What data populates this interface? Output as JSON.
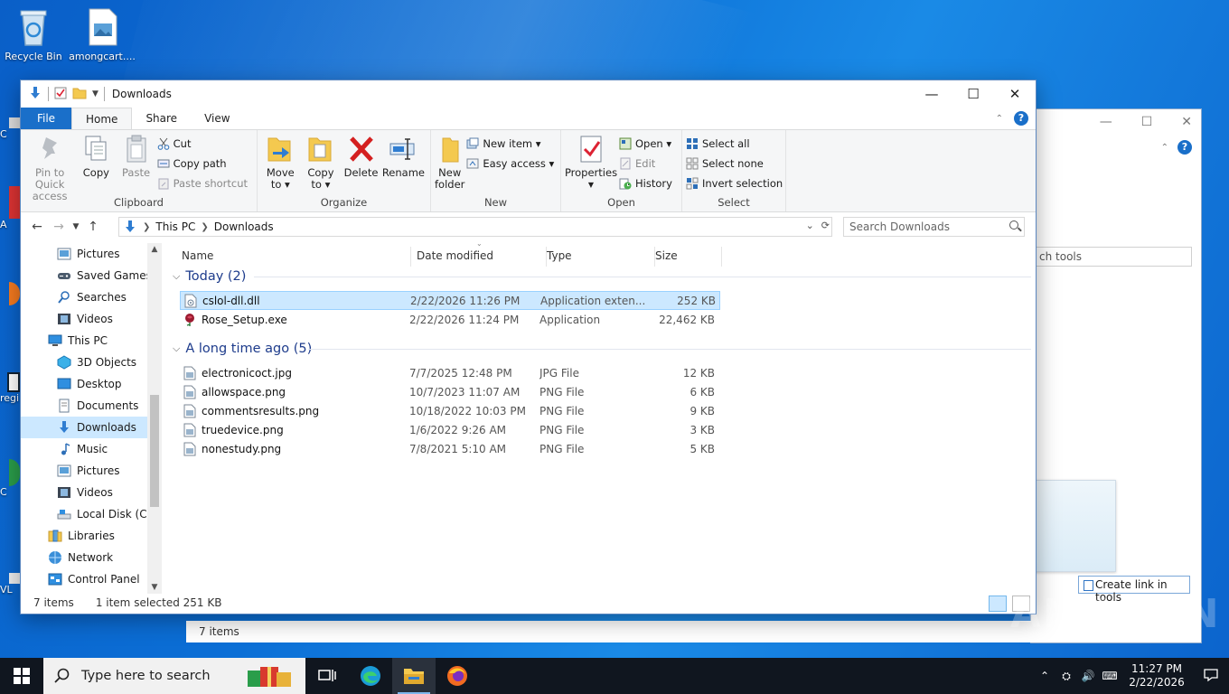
{
  "desktop": {
    "icons": [
      {
        "label": "Recycle Bin",
        "icon": "recycle-bin-icon"
      },
      {
        "label": "amongcart....",
        "icon": "image-file-icon"
      }
    ],
    "edge_labels": [
      "C",
      "A",
      "regi",
      "C",
      "VL"
    ]
  },
  "bg_window": {
    "search_placeholder": "ch tools",
    "create_link": "Create link in tools"
  },
  "window": {
    "title": "Downloads",
    "tabs": {
      "file": "File",
      "home": "Home",
      "share": "Share",
      "view": "View"
    },
    "ribbon": {
      "clipboard": {
        "label": "Clipboard",
        "pin": "Pin to Quick access",
        "copy": "Copy",
        "paste": "Paste",
        "cut": "Cut",
        "copy_path": "Copy path",
        "paste_shortcut": "Paste shortcut"
      },
      "organize": {
        "label": "Organize",
        "move_to": "Move to ▾",
        "copy_to": "Copy to ▾",
        "delete": "Delete",
        "rename": "Rename"
      },
      "new": {
        "label": "New",
        "new_folder": "New folder",
        "new_item": "New item ▾",
        "easy_access": "Easy access ▾"
      },
      "open": {
        "label": "Open",
        "properties": "Properties",
        "open": "Open ▾",
        "edit": "Edit",
        "history": "History"
      },
      "select": {
        "label": "Select",
        "select_all": "Select all",
        "select_none": "Select none",
        "invert": "Invert selection"
      }
    },
    "address": {
      "crumbs": [
        "This PC",
        "Downloads"
      ]
    },
    "search_placeholder": "Search Downloads",
    "nav": [
      {
        "label": "Pictures",
        "level": 1,
        "icon": "pictures-icon"
      },
      {
        "label": "Saved Games",
        "level": 1,
        "icon": "saved-games-icon"
      },
      {
        "label": "Searches",
        "level": 1,
        "icon": "searches-icon"
      },
      {
        "label": "Videos",
        "level": 1,
        "icon": "videos-icon"
      },
      {
        "label": "This PC",
        "level": 0,
        "icon": "this-pc-icon"
      },
      {
        "label": "3D Objects",
        "level": 1,
        "icon": "3d-objects-icon"
      },
      {
        "label": "Desktop",
        "level": 1,
        "icon": "desktop-icon"
      },
      {
        "label": "Documents",
        "level": 1,
        "icon": "documents-icon"
      },
      {
        "label": "Downloads",
        "level": 1,
        "icon": "downloads-icon",
        "selected": true
      },
      {
        "label": "Music",
        "level": 1,
        "icon": "music-icon"
      },
      {
        "label": "Pictures",
        "level": 1,
        "icon": "pictures-icon"
      },
      {
        "label": "Videos",
        "level": 1,
        "icon": "videos-icon"
      },
      {
        "label": "Local Disk (C:)",
        "level": 1,
        "icon": "local-disk-icon"
      },
      {
        "label": "Libraries",
        "level": 0,
        "icon": "libraries-icon"
      },
      {
        "label": "Network",
        "level": 0,
        "icon": "network-icon"
      },
      {
        "label": "Control Panel",
        "level": 0,
        "icon": "control-panel-icon"
      }
    ],
    "columns": {
      "name": "Name",
      "date": "Date modified",
      "type": "Type",
      "size": "Size"
    },
    "groups": [
      {
        "title": "Today (2)",
        "files": [
          {
            "name": "cslol-dll.dll",
            "date": "2/22/2026 11:26 PM",
            "type": "Application exten...",
            "size": "252 KB",
            "selected": true,
            "icon": "dll-file-icon"
          },
          {
            "name": "Rose_Setup.exe",
            "date": "2/22/2026 11:24 PM",
            "type": "Application",
            "size": "22,462 KB",
            "icon": "rose-exe-icon"
          }
        ]
      },
      {
        "title": "A long time ago (5)",
        "files": [
          {
            "name": "electronicoct.jpg",
            "date": "7/7/2025 12:48 PM",
            "type": "JPG File",
            "size": "12 KB",
            "icon": "image-file-icon"
          },
          {
            "name": "allowspace.png",
            "date": "10/7/2023 11:07 AM",
            "type": "PNG File",
            "size": "6 KB",
            "icon": "image-file-icon"
          },
          {
            "name": "commentsresults.png",
            "date": "10/18/2022 10:03 PM",
            "type": "PNG File",
            "size": "9 KB",
            "icon": "image-file-icon"
          },
          {
            "name": "truedevice.png",
            "date": "1/6/2022 9:26 AM",
            "type": "PNG File",
            "size": "3 KB",
            "icon": "image-file-icon"
          },
          {
            "name": "nonestudy.png",
            "date": "7/8/2021 5:10 AM",
            "type": "PNG File",
            "size": "5 KB",
            "icon": "image-file-icon"
          }
        ]
      }
    ],
    "status": {
      "count": "7 items",
      "selection": "1 item selected  251 KB"
    }
  },
  "status2": "7 items",
  "taskbar": {
    "search_placeholder": "Type here to search",
    "time": "11:27 PM",
    "date": "2/22/2026"
  },
  "watermark": "ANY.RUN",
  "colors": {
    "accent": "#1a6fc9",
    "selection": "#cce8ff",
    "group_title": "#1e3c8c",
    "taskbar": "#10161f"
  }
}
